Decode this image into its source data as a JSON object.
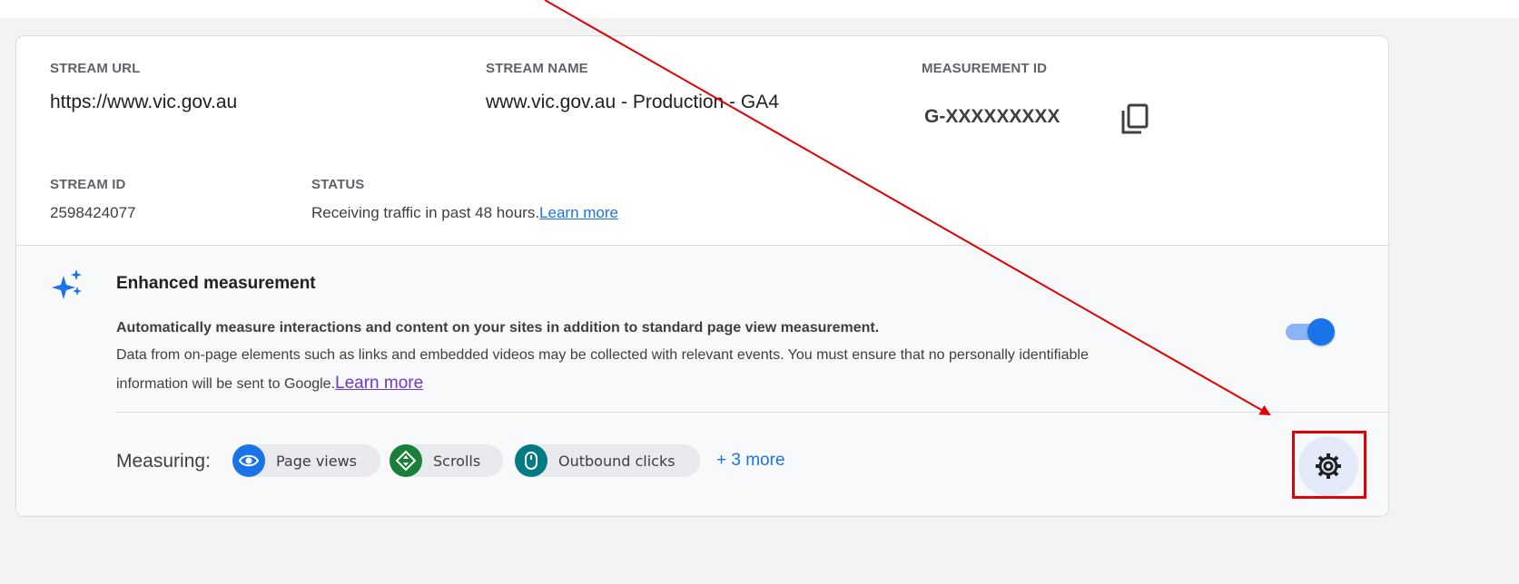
{
  "stream": {
    "url_label": "STREAM URL",
    "url_value": "https://www.vic.gov.au",
    "name_label": "STREAM NAME",
    "name_value": "www.vic.gov.au - Production - GA4",
    "measurement_label": "MEASUREMENT ID",
    "measurement_value": "G-XXXXXXXXX",
    "id_label": "STREAM ID",
    "id_value": "2598424077",
    "status_label": "STATUS",
    "status_value": "Receiving traffic in past 48 hours.",
    "status_link": "Learn more"
  },
  "enhanced": {
    "title": "Enhanced measurement",
    "desc_bold": "Automatically measure interactions and content on your sites in addition to standard page view measurement.",
    "desc_line2": "Data from on-page elements such as links and embedded videos may be collected with relevant events. You must ensure that no personally identifiable",
    "desc_line3": "information will be sent to Google.",
    "desc_link": "Learn more",
    "toggle_on": true,
    "measuring_label": "Measuring:",
    "chips": [
      {
        "label": "Page views",
        "icon": "eye-icon",
        "color": "#1a73e8"
      },
      {
        "label": "Scrolls",
        "icon": "scroll-icon",
        "color": "#188038"
      },
      {
        "label": "Outbound clicks",
        "icon": "mouse-icon",
        "color": "#007b83"
      }
    ],
    "more_label": "+ 3 more"
  },
  "icons": {
    "copy": "copy-icon",
    "sparkle": "sparkle-icon",
    "settings": "gear-icon"
  },
  "annotation": {
    "arrow_color": "#e00000",
    "highlight_color": "#e00000"
  }
}
